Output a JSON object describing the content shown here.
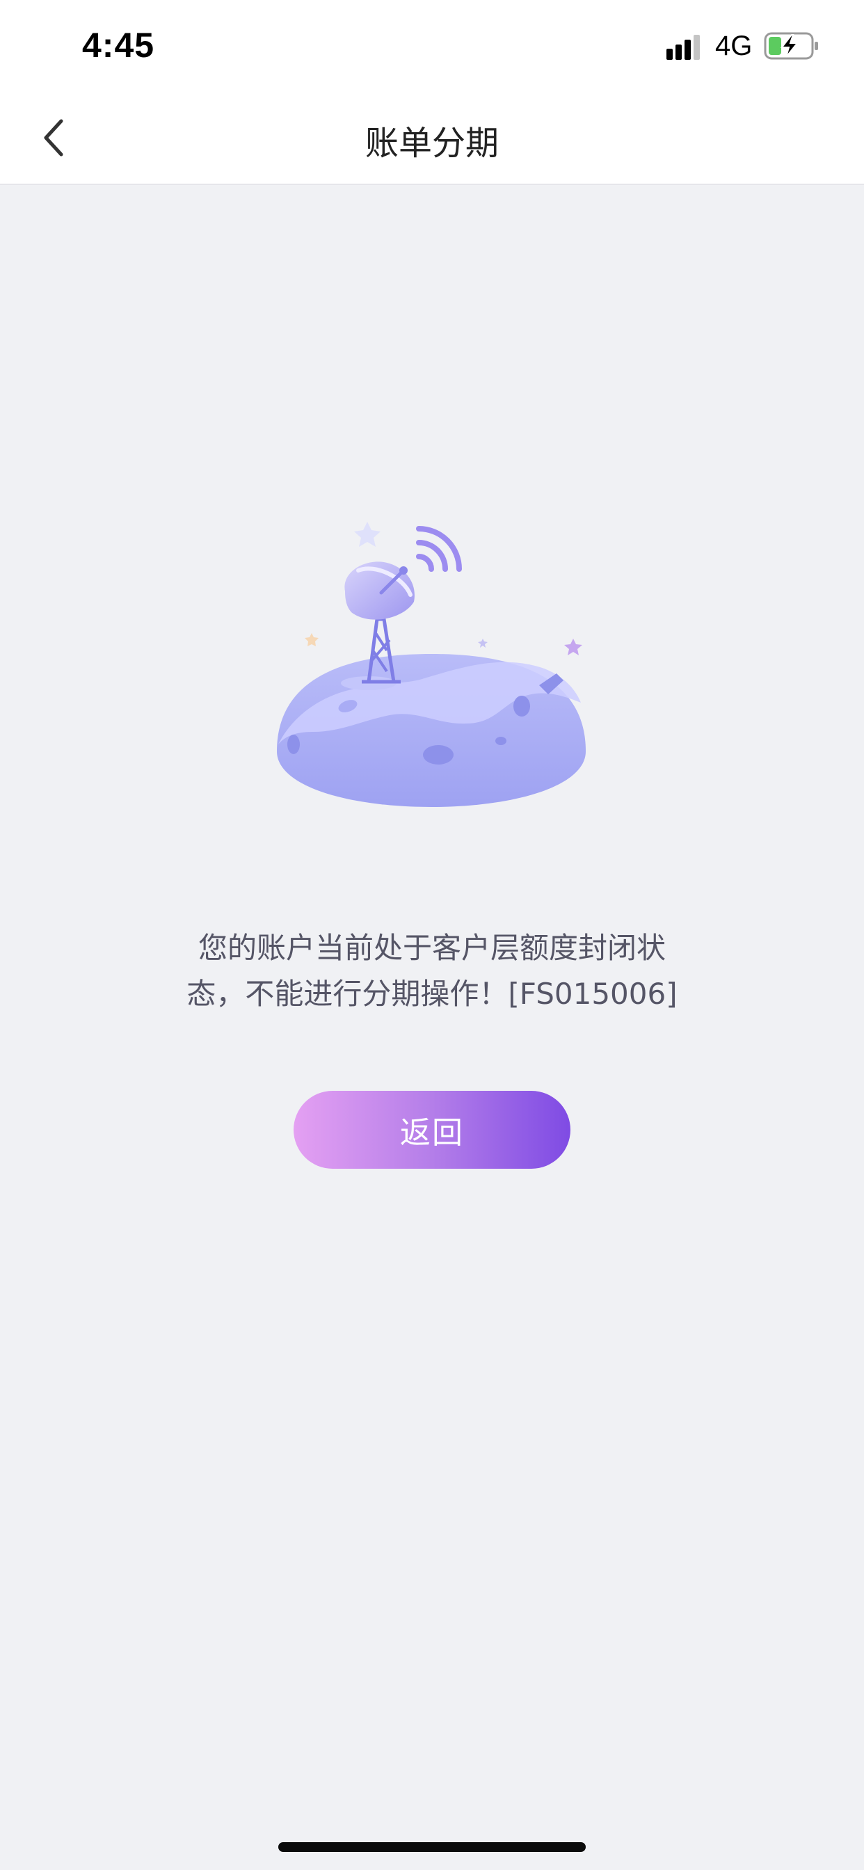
{
  "status_bar": {
    "time": "4:45",
    "network": "4G",
    "signal_icon": "cellular-signal-icon",
    "battery_icon": "battery-charging-icon"
  },
  "nav": {
    "title": "账单分期",
    "back_icon": "chevron-left-icon"
  },
  "illustration": {
    "icon": "satellite-dish-planet-illustration"
  },
  "message": {
    "line1": "您的账户当前处于客户层额度封闭状",
    "line2": "态，不能进行分期操作！[FS015006]"
  },
  "actions": {
    "return_label": "返回"
  },
  "colors": {
    "background": "#f0f1f4",
    "button_gradient_start": "#e4a0f2",
    "button_gradient_end": "#7f4be4",
    "illustration_primary": "#a6a8f4"
  }
}
